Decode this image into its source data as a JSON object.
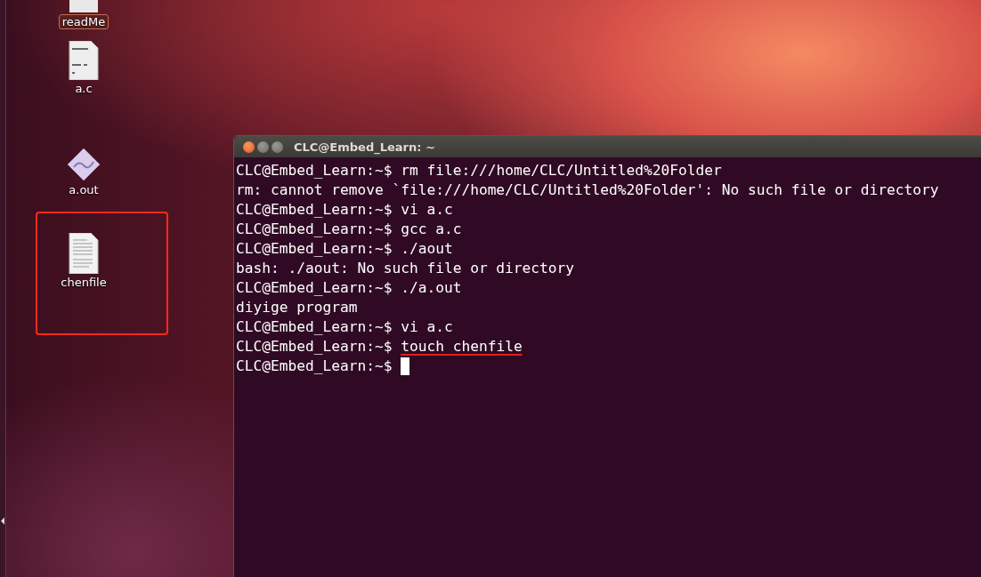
{
  "desktop_icons": [
    {
      "label": "readMe",
      "kind": "blank",
      "selected": true,
      "highlighted": false
    },
    {
      "label": "a.c",
      "kind": "source",
      "selected": false,
      "highlighted": false
    },
    {
      "label": "a.out",
      "kind": "executable",
      "selected": false,
      "highlighted": false
    },
    {
      "label": "chenfile",
      "kind": "document",
      "selected": false,
      "highlighted": true
    }
  ],
  "terminal": {
    "title": "CLC@Embed_Learn: ~",
    "lines": [
      {
        "kind": "prompt",
        "prompt": "CLC@Embed_Learn:~$",
        "command": "rm file:///home/CLC/Untitled%20Folder"
      },
      {
        "kind": "output",
        "text": "rm: cannot remove `file:///home/CLC/Untitled%20Folder': No such file or directory"
      },
      {
        "kind": "prompt",
        "prompt": "CLC@Embed_Learn:~$",
        "command": "vi a.c"
      },
      {
        "kind": "prompt",
        "prompt": "CLC@Embed_Learn:~$",
        "command": "gcc a.c"
      },
      {
        "kind": "prompt",
        "prompt": "CLC@Embed_Learn:~$",
        "command": "./aout"
      },
      {
        "kind": "output",
        "text": "bash: ./aout: No such file or directory"
      },
      {
        "kind": "prompt",
        "prompt": "CLC@Embed_Learn:~$",
        "command": "./a.out"
      },
      {
        "kind": "output",
        "text": "diyige program"
      },
      {
        "kind": "prompt",
        "prompt": "CLC@Embed_Learn:~$",
        "command": "vi a.c"
      },
      {
        "kind": "prompt",
        "prompt": "CLC@Embed_Learn:~$",
        "command": "touch chenfile",
        "underlined": true
      },
      {
        "kind": "prompt",
        "prompt": "CLC@Embed_Learn:~$",
        "cursor": true
      }
    ]
  }
}
